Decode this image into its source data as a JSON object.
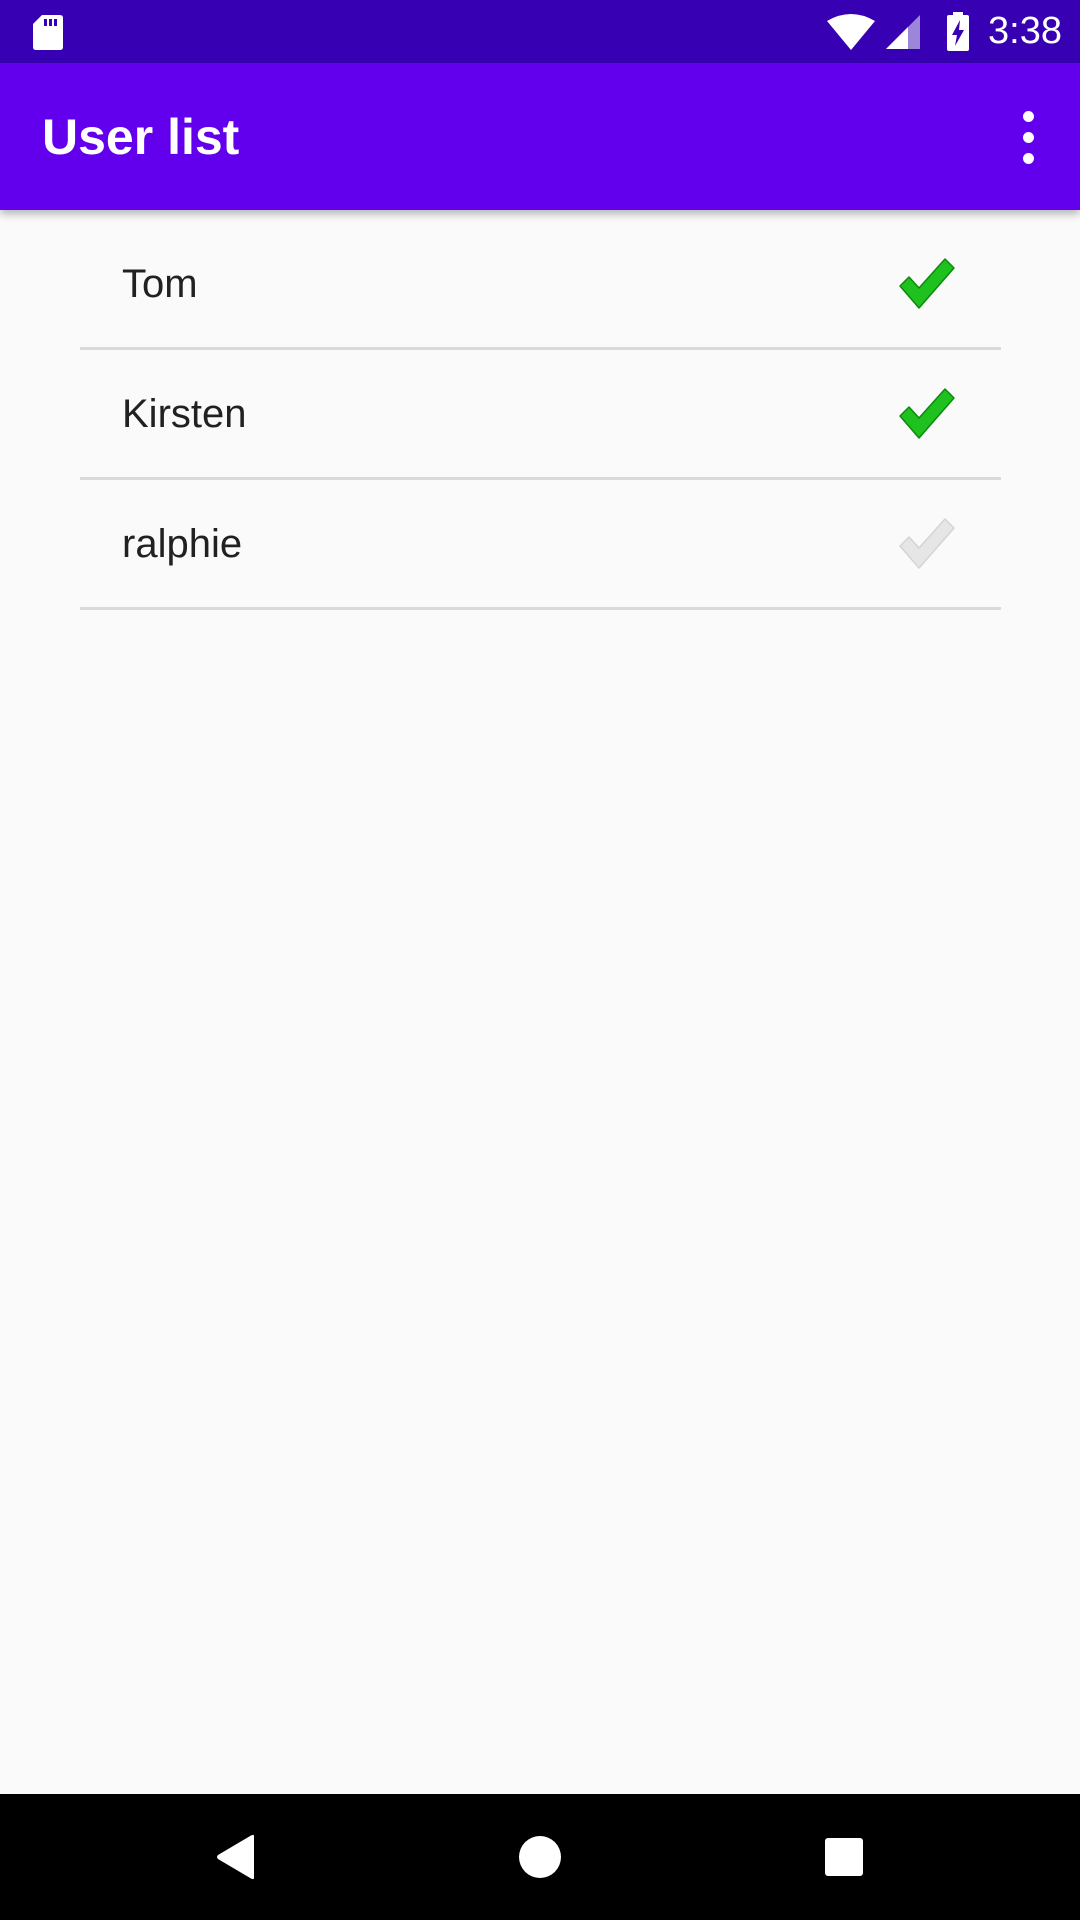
{
  "status_bar": {
    "time": "3:38",
    "icons": [
      "sd-card-icon",
      "wifi-icon",
      "cell-signal-icon",
      "battery-charging-icon"
    ]
  },
  "app_bar": {
    "title": "User list",
    "menu_icon": "more-vert-icon"
  },
  "users": [
    {
      "name": "Tom",
      "checked": true
    },
    {
      "name": "Kirsten",
      "checked": true
    },
    {
      "name": "ralphie",
      "checked": false
    }
  ],
  "colors": {
    "status_bar": "#3700b3",
    "app_bar": "#6200ee",
    "check_on": "#1fc11f",
    "check_off": "#e6e6e6"
  },
  "nav_bar": {
    "buttons": [
      "back-icon",
      "home-icon",
      "recents-icon"
    ]
  }
}
